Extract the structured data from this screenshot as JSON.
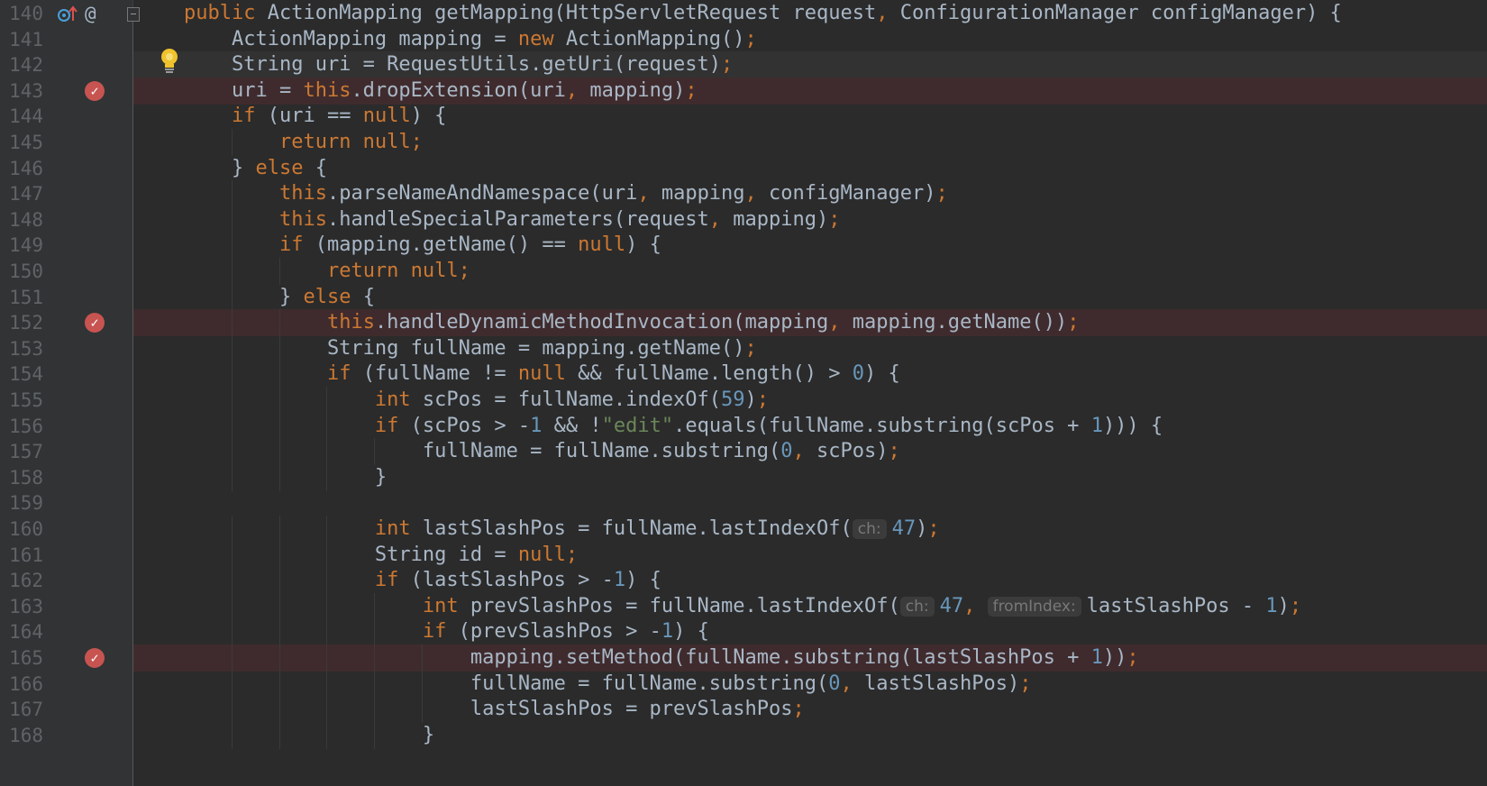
{
  "editor": {
    "colors": {
      "background": "#2b2b2b",
      "gutter": "#313335",
      "keyword": "#cc7832",
      "number": "#6897bb",
      "string": "#6a8759",
      "identifier": "#a9b7c6",
      "breakpoint_line": "#3f2b2d",
      "breakpoint_icon": "#c75450"
    },
    "icons": {
      "override": "override-gutter-icon",
      "annotation": "at-sign-icon",
      "fold": "fold-toggle-icon",
      "intention": "lightbulb-icon",
      "breakpoint": "verified-breakpoint-icon"
    },
    "at_sign": "@",
    "breakpoint_glyph": "✓",
    "lines": [
      {
        "n": "140",
        "t": [
          [
            "kw",
            "public "
          ],
          [
            "p",
            "ActionMapping getMapping(HttpServletRequest request"
          ],
          [
            "kw",
            ", "
          ],
          [
            "p",
            "ConfigurationManager configManager) {"
          ]
        ]
      },
      {
        "n": "141",
        "t": [
          [
            "p",
            "    ActionMapping mapping = "
          ],
          [
            "kw",
            "new "
          ],
          [
            "p",
            "ActionMapping()"
          ],
          [
            "kw",
            ";"
          ]
        ]
      },
      {
        "n": "142",
        "t": [
          [
            "p",
            "    String uri = RequestUtils.getUri(request)"
          ],
          [
            "kw",
            ";"
          ]
        ]
      },
      {
        "n": "143",
        "t": [
          [
            "p",
            "    uri = "
          ],
          [
            "kw",
            "this"
          ],
          [
            "p",
            ".dropExtension(uri"
          ],
          [
            "kw",
            ", "
          ],
          [
            "p",
            "mapping)"
          ],
          [
            "kw",
            ";"
          ]
        ]
      },
      {
        "n": "144",
        "t": [
          [
            "p",
            "    "
          ],
          [
            "kw",
            "if "
          ],
          [
            "p",
            "(uri == "
          ],
          [
            "kw",
            "null"
          ],
          [
            "p",
            ") {"
          ]
        ]
      },
      {
        "n": "145",
        "t": [
          [
            "p",
            "        "
          ],
          [
            "kw",
            "return null;"
          ]
        ]
      },
      {
        "n": "146",
        "t": [
          [
            "p",
            "    } "
          ],
          [
            "kw",
            "else "
          ],
          [
            "p",
            "{"
          ]
        ]
      },
      {
        "n": "147",
        "t": [
          [
            "p",
            "        "
          ],
          [
            "kw",
            "this"
          ],
          [
            "p",
            ".parseNameAndNamespace(uri"
          ],
          [
            "kw",
            ", "
          ],
          [
            "p",
            "mapping"
          ],
          [
            "kw",
            ", "
          ],
          [
            "p",
            "configManager)"
          ],
          [
            "kw",
            ";"
          ]
        ]
      },
      {
        "n": "148",
        "t": [
          [
            "p",
            "        "
          ],
          [
            "kw",
            "this"
          ],
          [
            "p",
            ".handleSpecialParameters(request"
          ],
          [
            "kw",
            ", "
          ],
          [
            "p",
            "mapping)"
          ],
          [
            "kw",
            ";"
          ]
        ]
      },
      {
        "n": "149",
        "t": [
          [
            "p",
            "        "
          ],
          [
            "kw",
            "if "
          ],
          [
            "p",
            "(mapping.getName() == "
          ],
          [
            "kw",
            "null"
          ],
          [
            "p",
            ") {"
          ]
        ]
      },
      {
        "n": "150",
        "t": [
          [
            "p",
            "            "
          ],
          [
            "kw",
            "return null;"
          ]
        ]
      },
      {
        "n": "151",
        "t": [
          [
            "p",
            "        } "
          ],
          [
            "kw",
            "else "
          ],
          [
            "p",
            "{"
          ]
        ]
      },
      {
        "n": "152",
        "t": [
          [
            "p",
            "            "
          ],
          [
            "kw",
            "this"
          ],
          [
            "p",
            ".handleDynamicMethodInvocation(mapping"
          ],
          [
            "kw",
            ", "
          ],
          [
            "p",
            "mapping.getName())"
          ],
          [
            "kw",
            ";"
          ]
        ]
      },
      {
        "n": "153",
        "t": [
          [
            "p",
            "            String fullName = mapping.getName()"
          ],
          [
            "kw",
            ";"
          ]
        ]
      },
      {
        "n": "154",
        "t": [
          [
            "p",
            "            "
          ],
          [
            "kw",
            "if "
          ],
          [
            "p",
            "(fullName != "
          ],
          [
            "kw",
            "null "
          ],
          [
            "p",
            "&& fullName.length() > "
          ],
          [
            "num",
            "0"
          ],
          [
            "p",
            ") {"
          ]
        ]
      },
      {
        "n": "155",
        "t": [
          [
            "p",
            "                "
          ],
          [
            "kw",
            "int "
          ],
          [
            "p",
            "scPos = fullName.indexOf("
          ],
          [
            "num",
            "59"
          ],
          [
            "p",
            ")"
          ],
          [
            "kw",
            ";"
          ]
        ]
      },
      {
        "n": "156",
        "t": [
          [
            "p",
            "                "
          ],
          [
            "kw",
            "if "
          ],
          [
            "p",
            "(scPos > -"
          ],
          [
            "num",
            "1 "
          ],
          [
            "p",
            "&& !"
          ],
          [
            "str",
            "\"edit\""
          ],
          [
            "p",
            ".equals(fullName.substring(scPos + "
          ],
          [
            "num",
            "1"
          ],
          [
            "p",
            "))) {"
          ]
        ]
      },
      {
        "n": "157",
        "t": [
          [
            "p",
            "                    fullName = fullName.substring("
          ],
          [
            "num",
            "0"
          ],
          [
            "kw",
            ", "
          ],
          [
            "p",
            "scPos)"
          ],
          [
            "kw",
            ";"
          ]
        ]
      },
      {
        "n": "158",
        "t": [
          [
            "p",
            "                }"
          ]
        ]
      },
      {
        "n": "159",
        "t": []
      },
      {
        "n": "160",
        "t": [
          [
            "p",
            "                "
          ],
          [
            "kw",
            "int "
          ],
          [
            "p",
            "lastSlashPos = fullName.lastIndexOf("
          ],
          [
            "hint",
            "ch:"
          ],
          [
            "num",
            "47"
          ],
          [
            "p",
            ")"
          ],
          [
            "kw",
            ";"
          ]
        ]
      },
      {
        "n": "161",
        "t": [
          [
            "p",
            "                String id = "
          ],
          [
            "kw",
            "null;"
          ]
        ]
      },
      {
        "n": "162",
        "t": [
          [
            "p",
            "                "
          ],
          [
            "kw",
            "if "
          ],
          [
            "p",
            "(lastSlashPos > -"
          ],
          [
            "num",
            "1"
          ],
          [
            "p",
            ") {"
          ]
        ]
      },
      {
        "n": "163",
        "t": [
          [
            "p",
            "                    "
          ],
          [
            "kw",
            "int "
          ],
          [
            "p",
            "prevSlashPos = fullName.lastIndexOf("
          ],
          [
            "hint",
            "ch:"
          ],
          [
            "num",
            "47"
          ],
          [
            "kw",
            ", "
          ],
          [
            "hint",
            "fromIndex:"
          ],
          [
            "p",
            "lastSlashPos - "
          ],
          [
            "num",
            "1"
          ],
          [
            "p",
            ")"
          ],
          [
            "kw",
            ";"
          ]
        ]
      },
      {
        "n": "164",
        "t": [
          [
            "p",
            "                    "
          ],
          [
            "kw",
            "if "
          ],
          [
            "p",
            "(prevSlashPos > -"
          ],
          [
            "num",
            "1"
          ],
          [
            "p",
            ") {"
          ]
        ]
      },
      {
        "n": "165",
        "t": [
          [
            "p",
            "                        mapping.setMethod(fullName.substring(lastSlashPos + "
          ],
          [
            "num",
            "1"
          ],
          [
            "p",
            "))"
          ],
          [
            "kw",
            ";"
          ]
        ]
      },
      {
        "n": "166",
        "t": [
          [
            "p",
            "                        fullName = fullName.substring("
          ],
          [
            "num",
            "0"
          ],
          [
            "kw",
            ", "
          ],
          [
            "p",
            "lastSlashPos)"
          ],
          [
            "kw",
            ";"
          ]
        ]
      },
      {
        "n": "167",
        "t": [
          [
            "p",
            "                        lastSlashPos = prevSlashPos"
          ],
          [
            "kw",
            ";"
          ]
        ]
      },
      {
        "n": "168",
        "t": [
          [
            "p",
            "                    }"
          ]
        ]
      }
    ],
    "breakpoint_lines": [
      "143",
      "152",
      "165"
    ],
    "caret_line": "142"
  }
}
